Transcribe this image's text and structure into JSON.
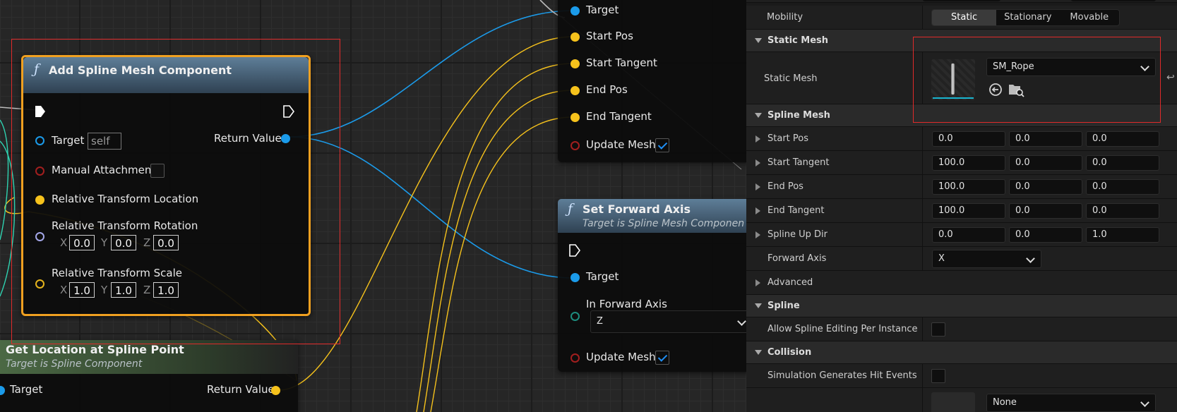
{
  "graph": {
    "add_spline_node": {
      "title": "Add Spline Mesh Component",
      "target_label": "Target",
      "target_default": "self",
      "return_label": "Return Value",
      "manual_attachment_label": "Manual Attachment",
      "rel_location_label": "Relative Transform Location",
      "rel_rotation_label": "Relative Transform Rotation",
      "rel_scale_label": "Relative Transform Scale",
      "rotation": {
        "x_label": "X",
        "y_label": "Y",
        "z_label": "Z",
        "x": "0.0",
        "y": "0.0",
        "z": "0.0"
      },
      "scale": {
        "x_label": "X",
        "y_label": "Y",
        "z_label": "Z",
        "x": "1.0",
        "y": "1.0",
        "z": "1.0"
      }
    },
    "set_start_end_node": {
      "pins": [
        "Target",
        "Start Pos",
        "Start Tangent",
        "End Pos",
        "End Tangent"
      ],
      "update_mesh_label": "Update Mesh",
      "update_mesh_checked": true
    },
    "set_forward_axis_node": {
      "title": "Set Forward Axis",
      "subtitle": "Target is Spline Mesh Componen",
      "target_label": "Target",
      "forward_axis_label": "In Forward Axis",
      "forward_axis_value": "Z",
      "update_mesh_label": "Update Mesh",
      "update_mesh_checked": true
    },
    "get_location_node": {
      "title": "Get Location at Spline Point",
      "subtitle": "Target is Spline Component",
      "target_label": "Target",
      "return_label": "Return Value"
    },
    "wire_colors": {
      "object": "#1b9bea",
      "vector": "#f6c21c",
      "struct": "#2fd3b1",
      "exec": "#bbbbbb"
    }
  },
  "details": {
    "mobility": {
      "label": "Mobility",
      "options": [
        "Static",
        "Stationary",
        "Movable"
      ],
      "selected": "Static"
    },
    "static_mesh_section": {
      "title": "Static Mesh",
      "label": "Static Mesh",
      "asset": "SM_Rope"
    },
    "spline_mesh_section": {
      "title": "Spline Mesh",
      "vectors": [
        {
          "label": "Start Pos",
          "values": [
            "0.0",
            "0.0",
            "0.0"
          ]
        },
        {
          "label": "Start Tangent",
          "values": [
            "100.0",
            "0.0",
            "0.0"
          ]
        },
        {
          "label": "End Pos",
          "values": [
            "100.0",
            "0.0",
            "0.0"
          ]
        },
        {
          "label": "End Tangent",
          "values": [
            "100.0",
            "0.0",
            "0.0"
          ]
        },
        {
          "label": "Spline Up Dir",
          "values": [
            "0.0",
            "0.0",
            "1.0"
          ]
        }
      ],
      "forward_axis": {
        "label": "Forward Axis",
        "value": "X"
      },
      "advanced_label": "Advanced"
    },
    "spline_section": {
      "title": "Spline",
      "allow_editing_label": "Allow Spline Editing Per Instance",
      "allow_editing_checked": false
    },
    "collision_section": {
      "title": "Collision",
      "sim_hit_events_label": "Simulation Generates Hit Events",
      "sim_hit_events_checked": false,
      "profile_value": "None"
    }
  },
  "highlight_color": "#e02a2a"
}
